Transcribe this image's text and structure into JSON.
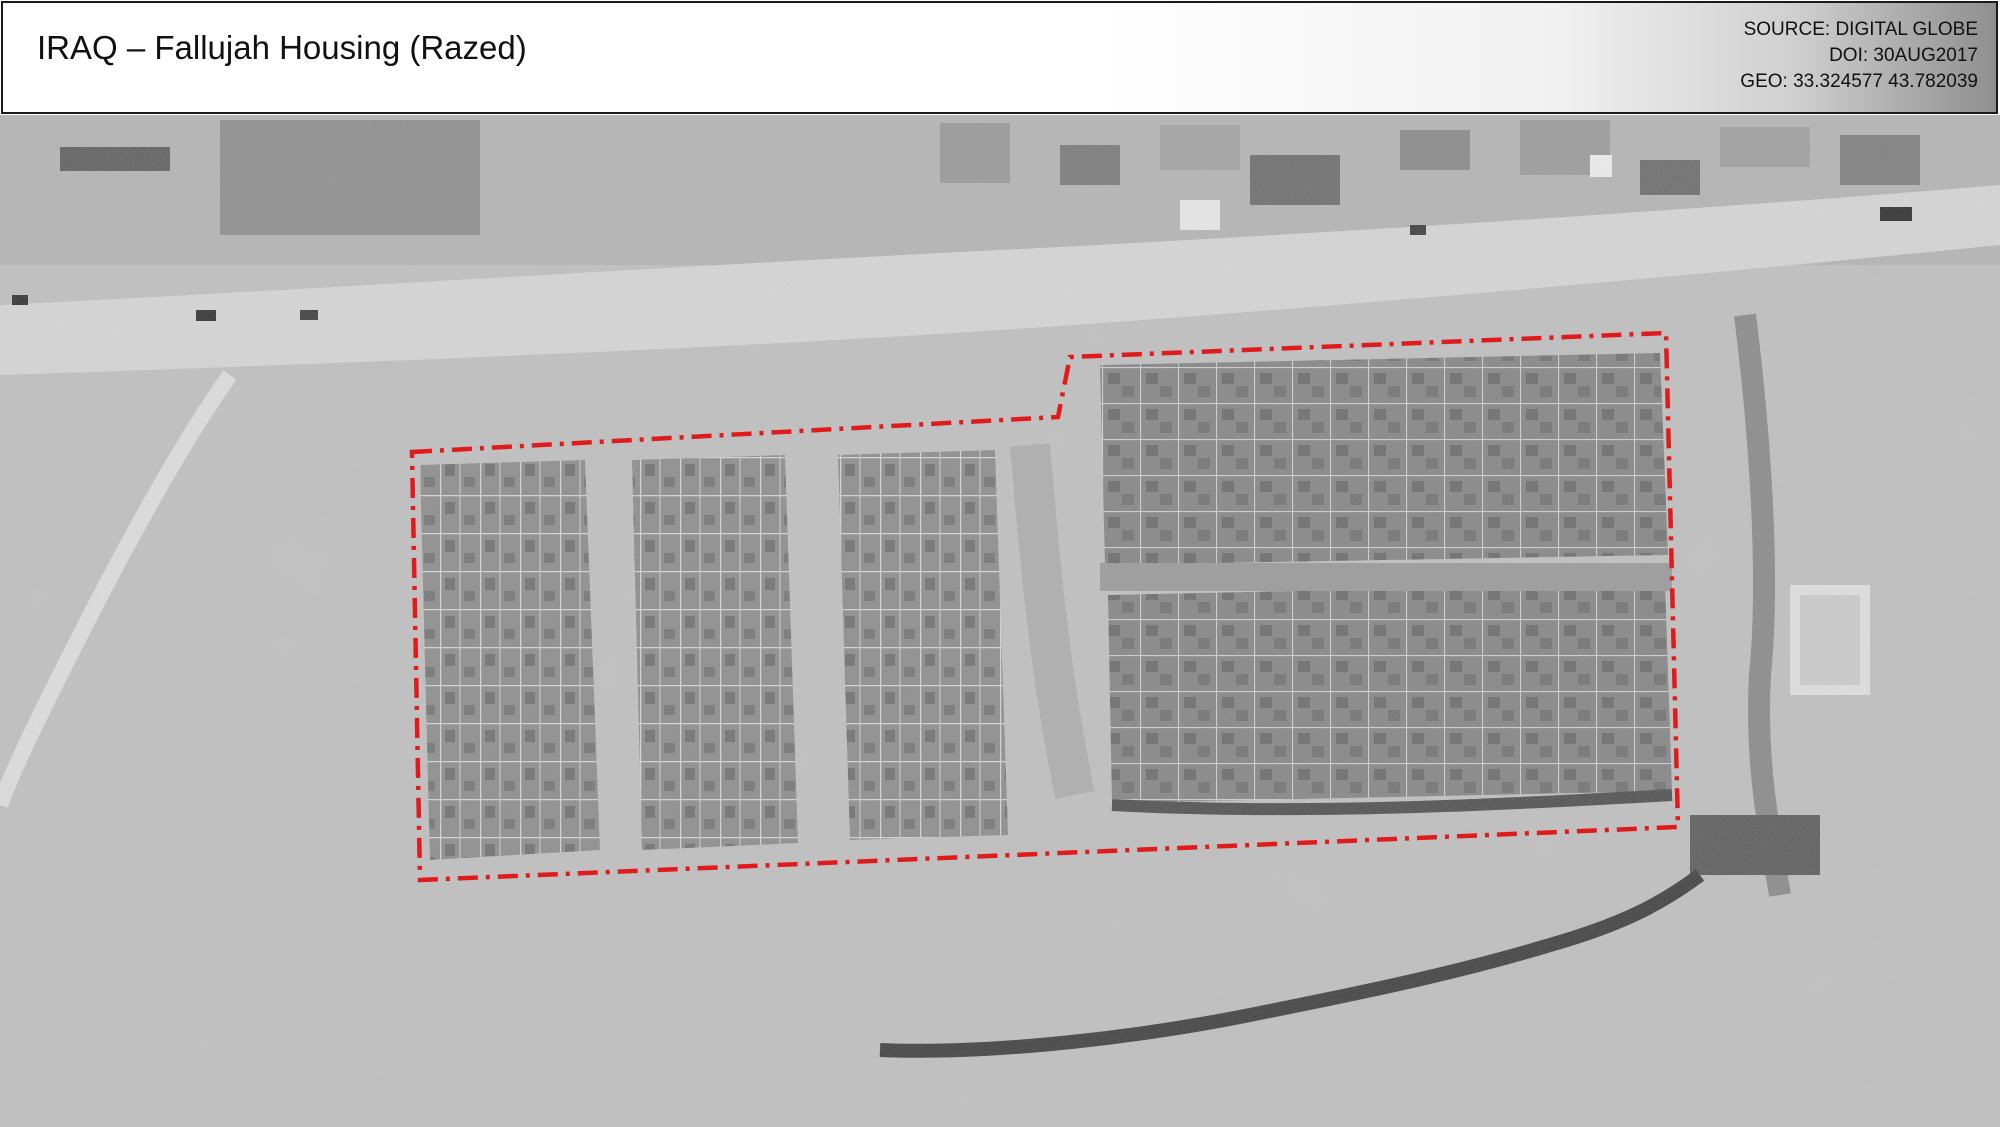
{
  "header": {
    "title": "IRAQ – Fallujah Housing (Razed)",
    "source": "SOURCE: DIGITAL GLOBE",
    "doi": "DOI: 30AUG2017",
    "geo": "GEO: 33.324577 43.782039"
  },
  "map": {
    "imagery_type": "grayscale satellite image",
    "boundary_style": "red dash-dot outline",
    "boundary_color": "#e01b1b",
    "features": [
      "road",
      "razed-housing-blocks",
      "berm",
      "buildings"
    ]
  }
}
